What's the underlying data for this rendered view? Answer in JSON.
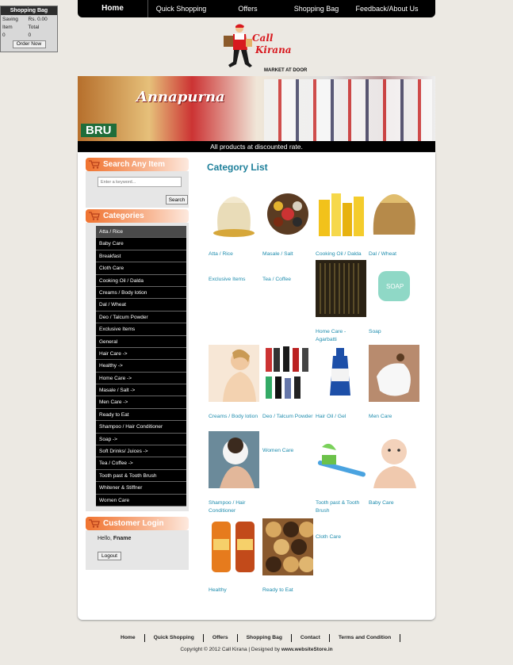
{
  "bag_widget": {
    "title": "Shopping Bag",
    "saving_label": "Saving",
    "saving_value": "Rs. 0.00",
    "item_header": "Item",
    "total_header": "Total",
    "item_count": "0",
    "total_value": "0",
    "order_button": "Order Now"
  },
  "nav": {
    "items": [
      "Home",
      "Quick Shopping",
      "Offers",
      "Shopping Bag",
      "Feedback/About Us"
    ]
  },
  "logo": {
    "call": "Call",
    "kirana": "Kirana",
    "tagline": "MARKET AT DOOR"
  },
  "banner": {
    "brand": "Annapurna",
    "bru": "BRU",
    "caption": "All products at discounted rate."
  },
  "search": {
    "title": "Search Any Item",
    "placeholder": "Enter a keyword...",
    "button": "Search"
  },
  "categories": {
    "title": "Categories",
    "items": [
      "Atta / Rice",
      "Baby Care",
      "Breakfast",
      "Cloth Care",
      "Cooking Oil / Dalda",
      "Creams / Body lotion",
      "Dal / Wheat",
      "Deo / Talcum Powder",
      "Exclusive Items",
      "General",
      "Hair Care  ->",
      "Healthy  ->",
      "Home Care  ->",
      "Masale / Salt  ->",
      "Men Care  ->",
      "Ready to Eat",
      "Shampoo / Hair Conditioner",
      "Soap  ->",
      "Soft Drinks/ Juices  ->",
      "Tea / Coffee  ->",
      "Tooth past & Tooth Brush",
      "Whitener & Stiffner",
      "Women Care"
    ],
    "active_index": 0
  },
  "login": {
    "title": "Customer Login",
    "hello": "Hello,",
    "name": "Fname",
    "logout": "Logout"
  },
  "content": {
    "title": "Category List",
    "tiles": [
      {
        "label": "Atta / Rice",
        "icon": "grain-sack-icon"
      },
      {
        "label": "Masale / Salt",
        "icon": "spice-tray-icon"
      },
      {
        "label": "Cooking Oil / Dalda",
        "icon": "oil-bottles-icon"
      },
      {
        "label": "Dal / Wheat",
        "icon": "wheat-sack-icon"
      },
      {
        "label": "Exclusive Items",
        "icon": ""
      },
      {
        "label": "Tea / Coffee",
        "icon": ""
      },
      {
        "label": "Home Care - Agarbatti",
        "icon": "incense-sticks-icon"
      },
      {
        "label": "Soap",
        "icon": "soap-bar-icon"
      },
      {
        "label": "Creams / Body lotion",
        "icon": "woman-lotion-icon"
      },
      {
        "label": "Deo / Talcum Powder",
        "icon": "deo-cans-icon"
      },
      {
        "label": "Hair Oil / Gel",
        "icon": "hair-oil-bottle-icon"
      },
      {
        "label": "Men Care",
        "icon": "shaving-man-icon"
      },
      {
        "label": "Shampoo / Hair Conditioner",
        "icon": "hair-wash-icon"
      },
      {
        "label": "Women Care",
        "icon": ""
      },
      {
        "label": "Tooth past & Tooth Brush",
        "icon": "toothbrush-icon"
      },
      {
        "label": "Baby Care",
        "icon": "baby-icon"
      },
      {
        "label": "Healthy",
        "icon": "health-drink-icon"
      },
      {
        "label": "Ready to Eat",
        "icon": "biscuits-icon"
      },
      {
        "label": "Cloth Care",
        "icon": ""
      }
    ]
  },
  "footer": {
    "links": [
      "Home",
      "Quick Shopping",
      "Offers",
      "Shopping Bag",
      "Contact",
      "Terms and Condition"
    ],
    "copyright": "Copyright © 2012 Call Kirana | Designed by",
    "designer": "www.websiteStore.in"
  }
}
